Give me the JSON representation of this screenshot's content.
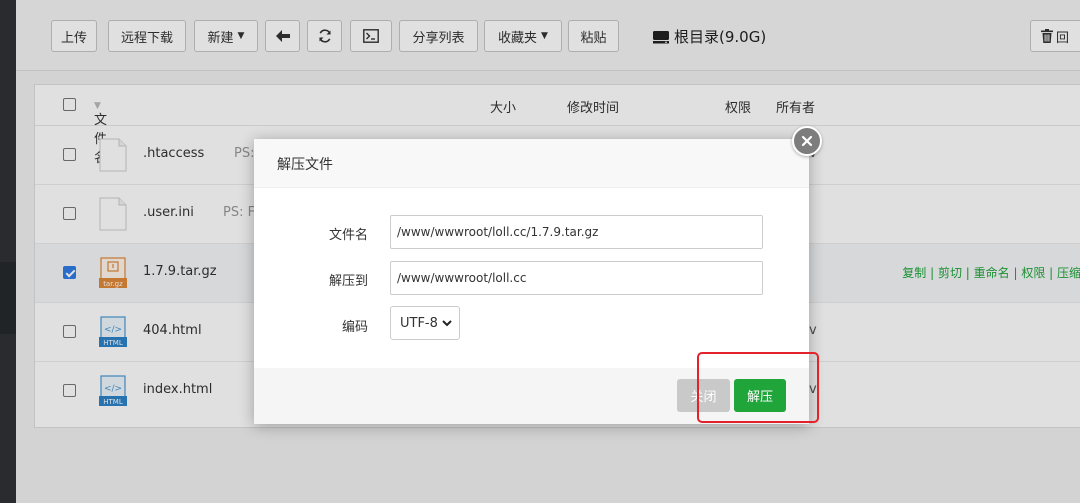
{
  "toolbar": {
    "upload": "上传",
    "remote_download": "远程下载",
    "new": "新建",
    "share_list": "分享列表",
    "favorites": "收藏夹",
    "paste": "粘贴",
    "root_dir": "根目录(9.0G)",
    "recycle_fragment": "回"
  },
  "table": {
    "headers": {
      "name": "文件名",
      "size": "大小",
      "mtime": "修改时间",
      "perm": "权限",
      "owner": "所有者"
    },
    "rows": [
      {
        "name": ".htaccess",
        "ps": "PS:",
        "owner_fragment": "v",
        "checked": false,
        "icon": "blank-file-icon"
      },
      {
        "name": ".user.ini",
        "ps": "PS: F",
        "owner_fragment": "",
        "checked": false,
        "icon": "blank-file-icon"
      },
      {
        "name": "1.7.9.tar.gz",
        "ps": "",
        "owner_fragment": "",
        "checked": true,
        "icon": "archive-file-icon",
        "archive_tag": "tar.gz",
        "actions": "复制 | 剪切 | 重命名 | 权限 | 压缩"
      },
      {
        "name": "404.html",
        "ps": "",
        "owner_fragment": "v",
        "checked": false,
        "icon": "html-file-icon",
        "tag": "HTML"
      },
      {
        "name": "index.html",
        "ps": "",
        "owner_fragment": "v",
        "checked": false,
        "icon": "html-file-icon",
        "tag": "HTML"
      }
    ]
  },
  "dialog": {
    "title": "解压文件",
    "filename_label": "文件名",
    "filename_value": "/www/wwwroot/loll.cc/1.7.9.tar.gz",
    "dest_label": "解压到",
    "dest_value": "/www/wwwroot/loll.cc",
    "encoding_label": "编码",
    "encoding_value": "UTF-8",
    "close_label": "关闭",
    "extract_label": "解压"
  },
  "colors": {
    "accent_green": "#20a53a",
    "highlight_red": "#e3222b",
    "checkbox_blue": "#2f7be5"
  }
}
